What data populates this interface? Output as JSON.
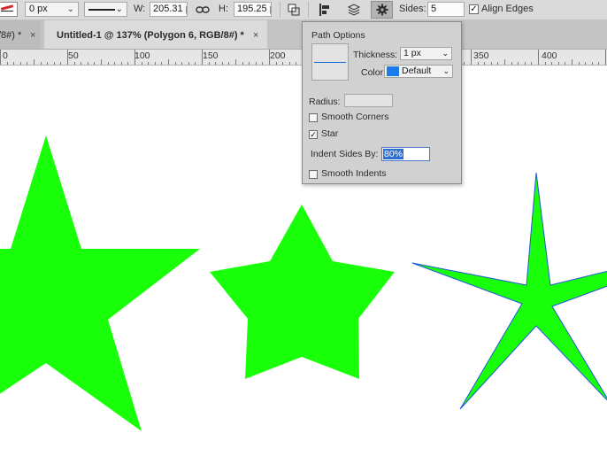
{
  "options_bar": {
    "stroke_width": "0 px",
    "w_label": "W:",
    "w_value": "205.31 p",
    "h_label": "H:",
    "h_value": "195.25 p",
    "sides_label": "Sides:",
    "sides_value": "5",
    "align_edges_label": "Align Edges",
    "align_edges_checked": true,
    "icons": [
      "stroke-swatch-icon",
      "stroke-type-icon",
      "link-icon",
      "path-operations-icon",
      "path-alignment-icon",
      "path-arrangement-icon",
      "gear-icon"
    ]
  },
  "tabs": [
    {
      "label": "/8#) *",
      "active": false
    },
    {
      "label": "Untitled-1 @ 137% (Polygon 6, RGB/8#) *",
      "active": true
    }
  ],
  "ruler": {
    "labels": [
      "0",
      "50",
      "100",
      "150",
      "200",
      "350",
      "400"
    ]
  },
  "path_options": {
    "title": "Path Options",
    "thickness_label": "Thickness:",
    "thickness_value": "1 px",
    "color_label": "Color:",
    "color_value": "Default",
    "color_swatch": "#1a7bea",
    "radius_label": "Radius:",
    "smooth_corners_label": "Smooth Corners",
    "smooth_corners_checked": false,
    "star_label": "Star",
    "star_checked": true,
    "indent_label": "Indent Sides By:",
    "indent_value": "80%",
    "smooth_indents_label": "Smooth Indents",
    "smooth_indents_checked": false
  },
  "canvas": {
    "fill_color": "#19ff0a",
    "selected_outline_color": "#2255dd"
  }
}
